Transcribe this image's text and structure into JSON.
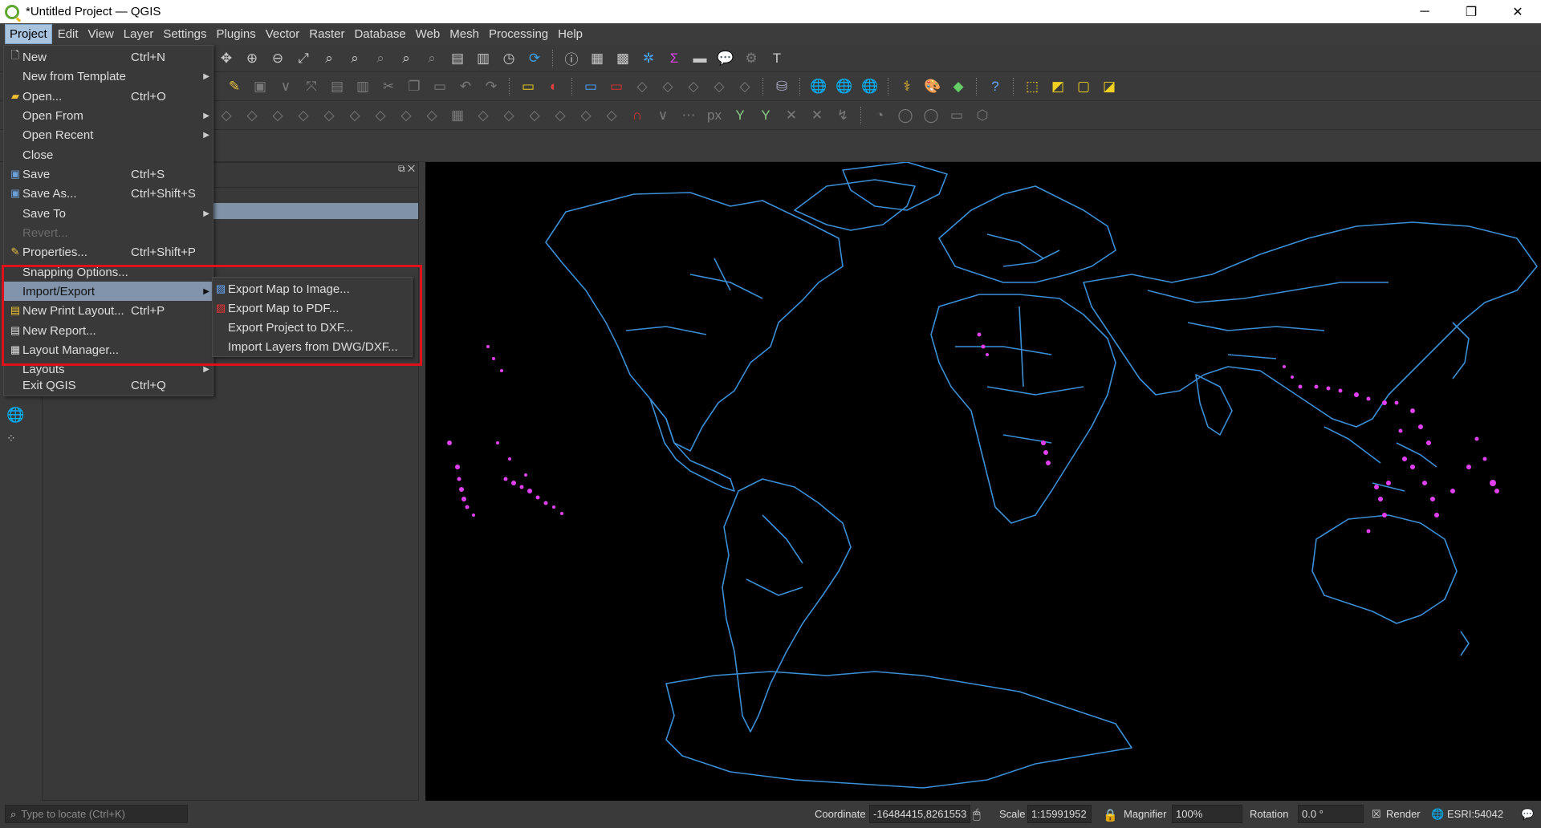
{
  "window": {
    "title": "*Untitled Project — QGIS",
    "controls": [
      "─",
      "❐",
      "✕"
    ]
  },
  "menubar": [
    "Project",
    "Edit",
    "View",
    "Layer",
    "Settings",
    "Plugins",
    "Vector",
    "Raster",
    "Database",
    "Web",
    "Mesh",
    "Processing",
    "Help"
  ],
  "project_menu": [
    {
      "label": "New",
      "shortcut": "Ctrl+N",
      "icon": "new-file-icon"
    },
    {
      "label": "New from Template",
      "shortcut": "",
      "submenu": true
    },
    {
      "label": "Open...",
      "shortcut": "Ctrl+O",
      "icon": "folder-icon"
    },
    {
      "label": "Open From",
      "shortcut": "",
      "submenu": true
    },
    {
      "label": "Open Recent",
      "shortcut": "",
      "submenu": true
    },
    {
      "label": "Close",
      "shortcut": ""
    },
    {
      "label": "Save",
      "shortcut": "Ctrl+S",
      "icon": "save-icon"
    },
    {
      "label": "Save As...",
      "shortcut": "Ctrl+Shift+S",
      "icon": "save-as-icon"
    },
    {
      "label": "Save To",
      "shortcut": "",
      "submenu": true
    },
    {
      "label": "Revert...",
      "shortcut": "",
      "disabled": true
    },
    {
      "label": "Properties...",
      "shortcut": "Ctrl+Shift+P",
      "icon": "properties-icon"
    },
    {
      "label": "Snapping Options...",
      "shortcut": ""
    },
    {
      "label": "Import/Export",
      "shortcut": "",
      "submenu": true,
      "highlighted": true
    },
    {
      "label": "New Print Layout...",
      "shortcut": "Ctrl+P",
      "icon": "print-layout-icon"
    },
    {
      "label": "New Report...",
      "shortcut": "",
      "icon": "report-icon"
    },
    {
      "label": "Layout Manager...",
      "shortcut": "",
      "icon": "layout-manager-icon"
    },
    {
      "label": "Layouts",
      "shortcut": "",
      "submenu": true
    },
    {
      "label": "Exit QGIS",
      "shortcut": "Ctrl+Q"
    }
  ],
  "import_export_submenu": [
    {
      "label": "Export Map to Image...",
      "icon": "export-image-icon"
    },
    {
      "label": "Export Map to PDF...",
      "icon": "export-pdf-icon"
    },
    {
      "label": "Export Project to DXF...",
      "icon": ""
    },
    {
      "label": "Import Layers from DWG/DXF...",
      "icon": ""
    }
  ],
  "statusbar": {
    "locator_placeholder": "Type to locate (Ctrl+K)",
    "coordinate_label": "Coordinate",
    "coordinate_value": "-16484415,8261553",
    "scale_label": "Scale",
    "scale_value": "1:15991952",
    "magnifier_label": "Magnifier",
    "magnifier_value": "100%",
    "rotation_label": "Rotation",
    "rotation_value": "0.0 °",
    "render_label": "Render",
    "crs_label": "ESRI:54042"
  },
  "colors": {
    "coastline": "#3b8fd6",
    "highlight_points": "#e040f0",
    "annotation_box": "#e0101a",
    "map_bg": "#000000"
  }
}
